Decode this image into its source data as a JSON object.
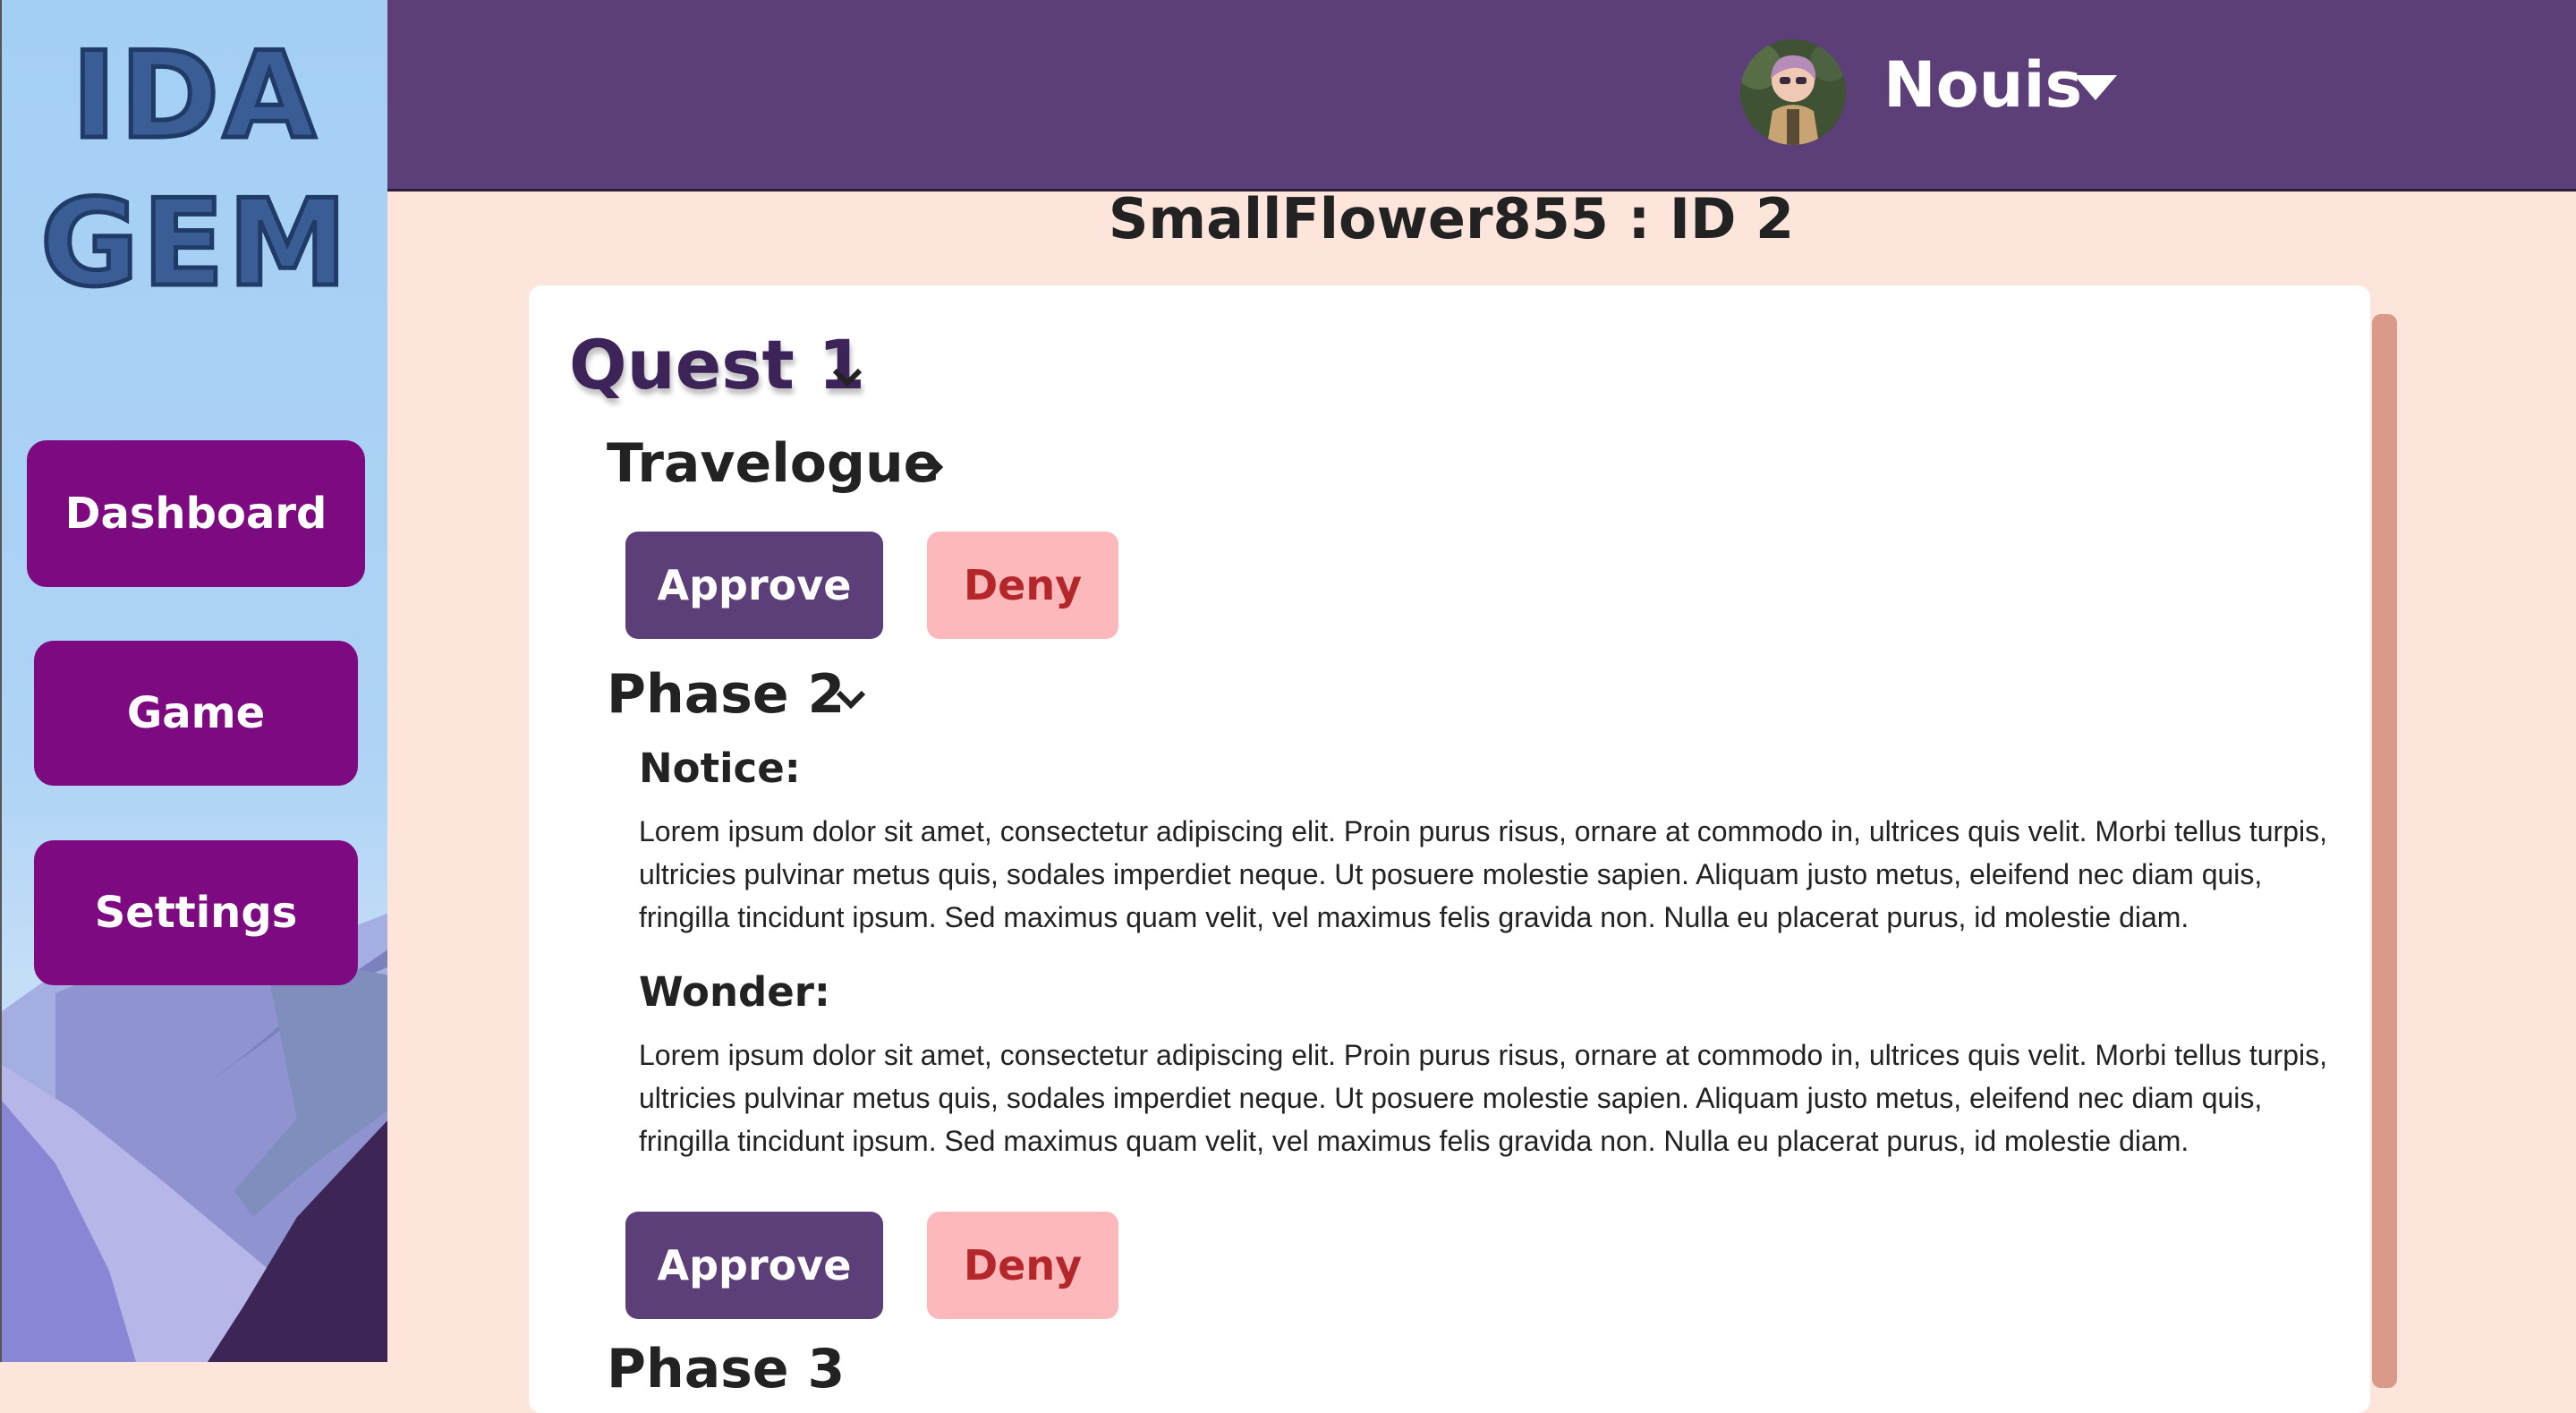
{
  "sidebar": {
    "logo_line1": "IDA",
    "logo_line2": "GEM",
    "nav": [
      {
        "label": "Dashboard"
      },
      {
        "label": "Game"
      },
      {
        "label": "Settings"
      }
    ]
  },
  "header": {
    "user_name": "Nouis",
    "icons": [
      "avatar",
      "caret-down-icon"
    ]
  },
  "main": {
    "title": "SmallFlower855 : ID 2",
    "quest_title": "Quest 1",
    "sections": [
      {
        "title": "Travelogue",
        "expanded": false,
        "approve_label": "Approve",
        "deny_label": "Deny"
      },
      {
        "title": "Phase 2",
        "expanded": true,
        "items": [
          {
            "label": "Notice:",
            "text": "Lorem ipsum dolor sit amet, consectetur adipiscing elit. Proin purus risus, ornare at commodo in, ultrices quis velit. Morbi tellus turpis, ultricies pulvinar metus quis, sodales imperdiet neque. Ut posuere molestie sapien. Aliquam justo metus, eleifend nec diam quis, fringilla tincidunt ipsum. Sed maximus quam velit, vel maximus felis gravida non. Nulla eu placerat purus, id molestie diam."
          },
          {
            "label": "Wonder:",
            "text": "Lorem ipsum dolor sit amet, consectetur adipiscing elit. Proin purus risus, ornare at commodo in, ultrices quis velit. Morbi tellus turpis, ultricies pulvinar metus quis, sodales imperdiet neque. Ut posuere molestie sapien. Aliquam justo metus, eleifend nec diam quis, fringilla tincidunt ipsum. Sed maximus quam velit, vel maximus felis gravida non. Nulla eu placerat purus, id molestie diam."
          }
        ],
        "approve_label": "Approve",
        "deny_label": "Deny"
      },
      {
        "title": "Phase 3"
      }
    ]
  },
  "colors": {
    "header_bg": "#5c3f79",
    "nav_bg": "#7d0a80",
    "page_bg": "#fee5dc",
    "approve_bg": "#5c3f79",
    "deny_bg": "#fcb8ba",
    "deny_text": "#b3262a"
  }
}
